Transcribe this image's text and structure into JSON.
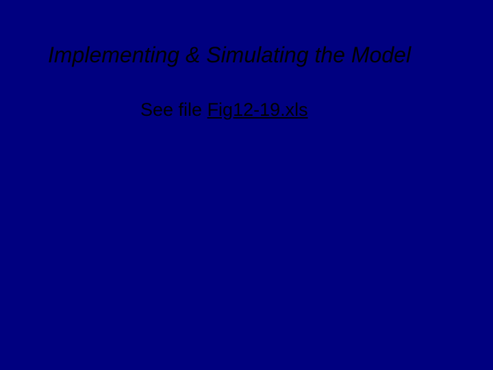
{
  "slide": {
    "title": "Implementing & Simulating the Model",
    "body_prefix": "See file ",
    "file_link": "Fig12-19.xls"
  }
}
